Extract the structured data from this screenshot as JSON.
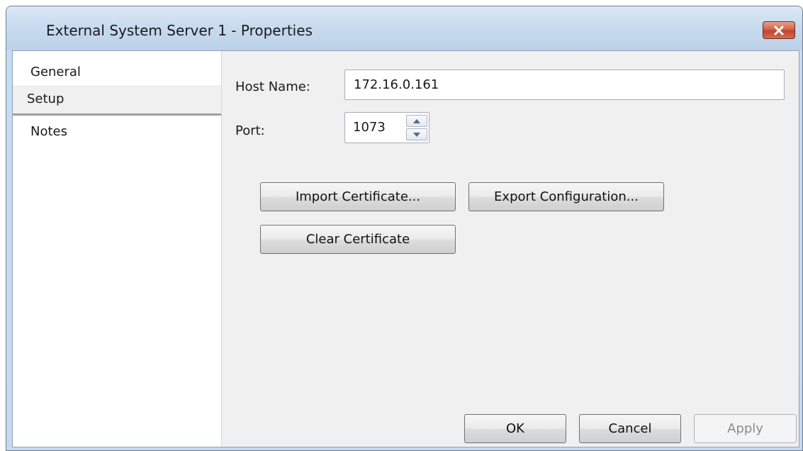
{
  "window": {
    "title": "External System Server 1 - Properties",
    "close_icon": "close-icon"
  },
  "sidebar": {
    "items": [
      {
        "label": "General"
      },
      {
        "label": "Setup",
        "selected": true
      },
      {
        "label": "Notes"
      }
    ]
  },
  "form": {
    "host_name_label": "Host Name:",
    "host_name_value": "172.16.0.161",
    "port_label": "Port:",
    "port_value": "1073",
    "spin_up_icon": "arrow-up-icon",
    "spin_down_icon": "arrow-down-icon"
  },
  "actions": {
    "import_certificate": "Import Certificate...",
    "export_configuration": "Export Configuration...",
    "clear_certificate": "Clear Certificate"
  },
  "footer": {
    "ok": "OK",
    "cancel": "Cancel",
    "apply": "Apply",
    "apply_enabled": false
  },
  "colors": {
    "titlebar": "#c8dbef",
    "close_button": "#c4422b",
    "client_background": "#f0f0f0"
  }
}
